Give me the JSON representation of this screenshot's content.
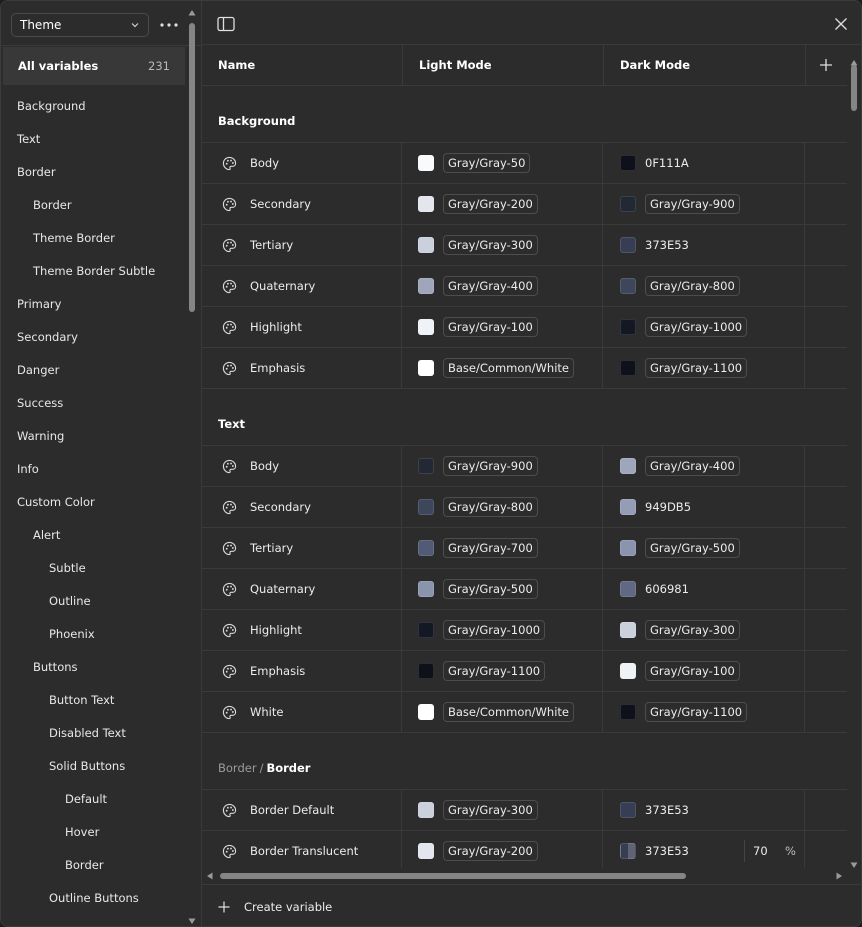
{
  "sidebar": {
    "collection": "Theme",
    "all_variables_label": "All variables",
    "all_variables_count": "231",
    "groups": [
      {
        "label": "Background",
        "level": 0
      },
      {
        "label": "Text",
        "level": 0
      },
      {
        "label": "Border",
        "level": 0
      },
      {
        "label": "Border",
        "level": 1
      },
      {
        "label": "Theme Border",
        "level": 1
      },
      {
        "label": "Theme Border Subtle",
        "level": 1
      },
      {
        "label": "Primary",
        "level": 0
      },
      {
        "label": "Secondary",
        "level": 0
      },
      {
        "label": "Danger",
        "level": 0
      },
      {
        "label": "Success",
        "level": 0
      },
      {
        "label": "Warning",
        "level": 0
      },
      {
        "label": "Info",
        "level": 0
      },
      {
        "label": "Custom Color",
        "level": 0
      },
      {
        "label": "Alert",
        "level": 1
      },
      {
        "label": "Subtle",
        "level": 2
      },
      {
        "label": "Outline",
        "level": 2
      },
      {
        "label": "Phoenix",
        "level": 2
      },
      {
        "label": "Buttons",
        "level": 1
      },
      {
        "label": "Button Text",
        "level": 2
      },
      {
        "label": "Disabled Text",
        "level": 2
      },
      {
        "label": "Solid Buttons",
        "level": 2
      },
      {
        "label": "Default",
        "level": 3
      },
      {
        "label": "Hover",
        "level": 3
      },
      {
        "label": "Border",
        "level": 3
      },
      {
        "label": "Outline Buttons",
        "level": 2
      }
    ]
  },
  "table": {
    "columns": [
      "Name",
      "Light Mode",
      "Dark Mode"
    ],
    "sections": [
      {
        "prefix": "",
        "title": "Background",
        "rows": [
          {
            "name": "Body",
            "light": {
              "swatch": "#F9FAFB",
              "label": "Gray/Gray-50",
              "chip": true
            },
            "dark": {
              "swatch": "#0F111A",
              "label": "0F111A",
              "chip": false
            }
          },
          {
            "name": "Secondary",
            "light": {
              "swatch": "#E3E6ED",
              "label": "Gray/Gray-200",
              "chip": true
            },
            "dark": {
              "swatch": "#222834",
              "label": "Gray/Gray-900",
              "chip": true
            }
          },
          {
            "name": "Tertiary",
            "light": {
              "swatch": "#CBD0DD",
              "label": "Gray/Gray-300",
              "chip": true
            },
            "dark": {
              "swatch": "#373E53",
              "label": "373E53",
              "chip": false
            }
          },
          {
            "name": "Quaternary",
            "light": {
              "swatch": "#9FA6BC",
              "label": "Gray/Gray-400",
              "chip": true
            },
            "dark": {
              "swatch": "#3E465B",
              "label": "Gray/Gray-800",
              "chip": true
            }
          },
          {
            "name": "Highlight",
            "light": {
              "swatch": "#EFF2F6",
              "label": "Gray/Gray-100",
              "chip": true
            },
            "dark": {
              "swatch": "#141824",
              "label": "Gray/Gray-1000",
              "chip": true
            }
          },
          {
            "name": "Emphasis",
            "light": {
              "swatch": "#FFFFFF",
              "label": "Base/Common/White",
              "chip": true
            },
            "dark": {
              "swatch": "#0F111A",
              "label": "Gray/Gray-1100",
              "chip": true
            }
          }
        ]
      },
      {
        "prefix": "",
        "title": "Text",
        "rows": [
          {
            "name": "Body",
            "light": {
              "swatch": "#222834",
              "label": "Gray/Gray-900",
              "chip": true
            },
            "dark": {
              "swatch": "#9FA6BC",
              "label": "Gray/Gray-400",
              "chip": true
            }
          },
          {
            "name": "Secondary",
            "light": {
              "swatch": "#3E465B",
              "label": "Gray/Gray-800",
              "chip": true
            },
            "dark": {
              "swatch": "#949DB5",
              "label": "949DB5",
              "chip": false
            }
          },
          {
            "name": "Tertiary",
            "light": {
              "swatch": "#525B75",
              "label": "Gray/Gray-700",
              "chip": true
            },
            "dark": {
              "swatch": "#8A94AD",
              "label": "Gray/Gray-500",
              "chip": true
            }
          },
          {
            "name": "Quaternary",
            "light": {
              "swatch": "#8A94AD",
              "label": "Gray/Gray-500",
              "chip": true
            },
            "dark": {
              "swatch": "#606981",
              "label": "606981",
              "chip": false
            }
          },
          {
            "name": "Highlight",
            "light": {
              "swatch": "#141824",
              "label": "Gray/Gray-1000",
              "chip": true
            },
            "dark": {
              "swatch": "#CBD0DD",
              "label": "Gray/Gray-300",
              "chip": true
            }
          },
          {
            "name": "Emphasis",
            "light": {
              "swatch": "#0F111A",
              "label": "Gray/Gray-1100",
              "chip": true
            },
            "dark": {
              "swatch": "#EFF2F6",
              "label": "Gray/Gray-100",
              "chip": true
            }
          },
          {
            "name": "White",
            "light": {
              "swatch": "#FFFFFF",
              "label": "Base/Common/White",
              "chip": true
            },
            "dark": {
              "swatch": "#0F111A",
              "label": "Gray/Gray-1100",
              "chip": true
            }
          }
        ]
      },
      {
        "prefix": "Border",
        "title": "Border",
        "rows": [
          {
            "name": "Border Default",
            "light": {
              "swatch": "#CBD0DD",
              "label": "Gray/Gray-300",
              "chip": true
            },
            "dark": {
              "swatch": "#373E53",
              "label": "373E53",
              "chip": false
            }
          },
          {
            "name": "Border Translucent",
            "light": {
              "swatch": "#E3E6ED",
              "label": "Gray/Gray-200",
              "chip": true
            },
            "dark": {
              "swatch": "half",
              "label": "373E53",
              "chip": false,
              "opacity": "70",
              "opacity_unit": "%"
            }
          }
        ]
      }
    ]
  },
  "footer": {
    "create_label": "Create variable"
  }
}
